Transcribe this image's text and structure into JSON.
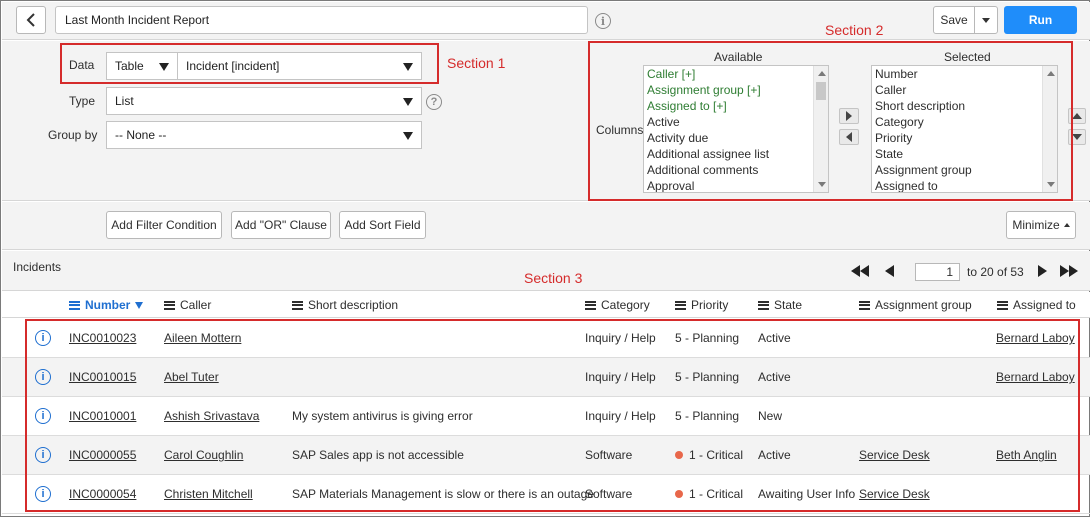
{
  "topbar": {
    "report_title": "Last Month Incident Report",
    "save_label": "Save",
    "run_label": "Run"
  },
  "config": {
    "data_label": "Data",
    "data_source_type": "Table",
    "data_source_table": "Incident [incident]",
    "type_label": "Type",
    "type_value": "List",
    "group_by_label": "Group by",
    "group_by_value": "-- None --",
    "columns_label": "Columns",
    "available_header": "Available",
    "selected_header": "Selected",
    "available_items": [
      {
        "label": "Caller [+]",
        "green": true
      },
      {
        "label": "Assignment group [+]",
        "green": true
      },
      {
        "label": "Assigned to [+]",
        "green": true
      },
      {
        "label": "Active",
        "green": false
      },
      {
        "label": "Activity due",
        "green": false
      },
      {
        "label": "Additional assignee list",
        "green": false
      },
      {
        "label": "Additional comments",
        "green": false
      },
      {
        "label": "Approval",
        "green": false
      }
    ],
    "selected_items": [
      "Number",
      "Caller",
      "Short description",
      "Category",
      "Priority",
      "State",
      "Assignment group",
      "Assigned to"
    ]
  },
  "annotations": {
    "section1": "Section 1",
    "section2": "Section 2",
    "section3": "Section 3"
  },
  "filters": {
    "add_filter_label": "Add Filter Condition",
    "add_or_label": "Add \"OR\" Clause",
    "add_sort_label": "Add Sort Field",
    "minimize_label": "Minimize"
  },
  "results": {
    "table_title": "Incidents",
    "page_value": "1",
    "range_text": "to 20 of 53",
    "columns": [
      "Number",
      "Caller",
      "Short description",
      "Category",
      "Priority",
      "State",
      "Assignment group",
      "Assigned to"
    ],
    "rows": [
      {
        "number": "INC0010023",
        "caller": "Aileen Mottern",
        "short_description": "",
        "category": "Inquiry / Help",
        "priority": "5 - Planning",
        "critical": false,
        "state": "Active",
        "assignment_group": "",
        "assigned_to": "Bernard Laboy"
      },
      {
        "number": "INC0010015",
        "caller": "Abel Tuter",
        "short_description": "",
        "category": "Inquiry / Help",
        "priority": "5 - Planning",
        "critical": false,
        "state": "Active",
        "assignment_group": "",
        "assigned_to": "Bernard Laboy"
      },
      {
        "number": "INC0010001",
        "caller": "Ashish Srivastava",
        "short_description": "My system antivirus is giving error",
        "category": "Inquiry / Help",
        "priority": "5 - Planning",
        "critical": false,
        "state": "New",
        "assignment_group": "",
        "assigned_to": ""
      },
      {
        "number": "INC0000055",
        "caller": "Carol Coughlin",
        "short_description": "SAP Sales app is not accessible",
        "category": "Software",
        "priority": "1 - Critical",
        "critical": true,
        "state": "Active",
        "assignment_group": "Service Desk",
        "assigned_to": "Beth Anglin"
      },
      {
        "number": "INC0000054",
        "caller": "Christen Mitchell",
        "short_description": "SAP Materials Management is slow or there is an outage",
        "category": "Software",
        "priority": "1 - Critical",
        "critical": true,
        "state": "Awaiting User Info",
        "assignment_group": "Service Desk",
        "assigned_to": ""
      }
    ]
  },
  "colors": {
    "accent": "#1f8dfa",
    "annotation_red": "#d52b2b",
    "critical_dot": "#e8674a",
    "reference_green": "#2e7d32"
  }
}
